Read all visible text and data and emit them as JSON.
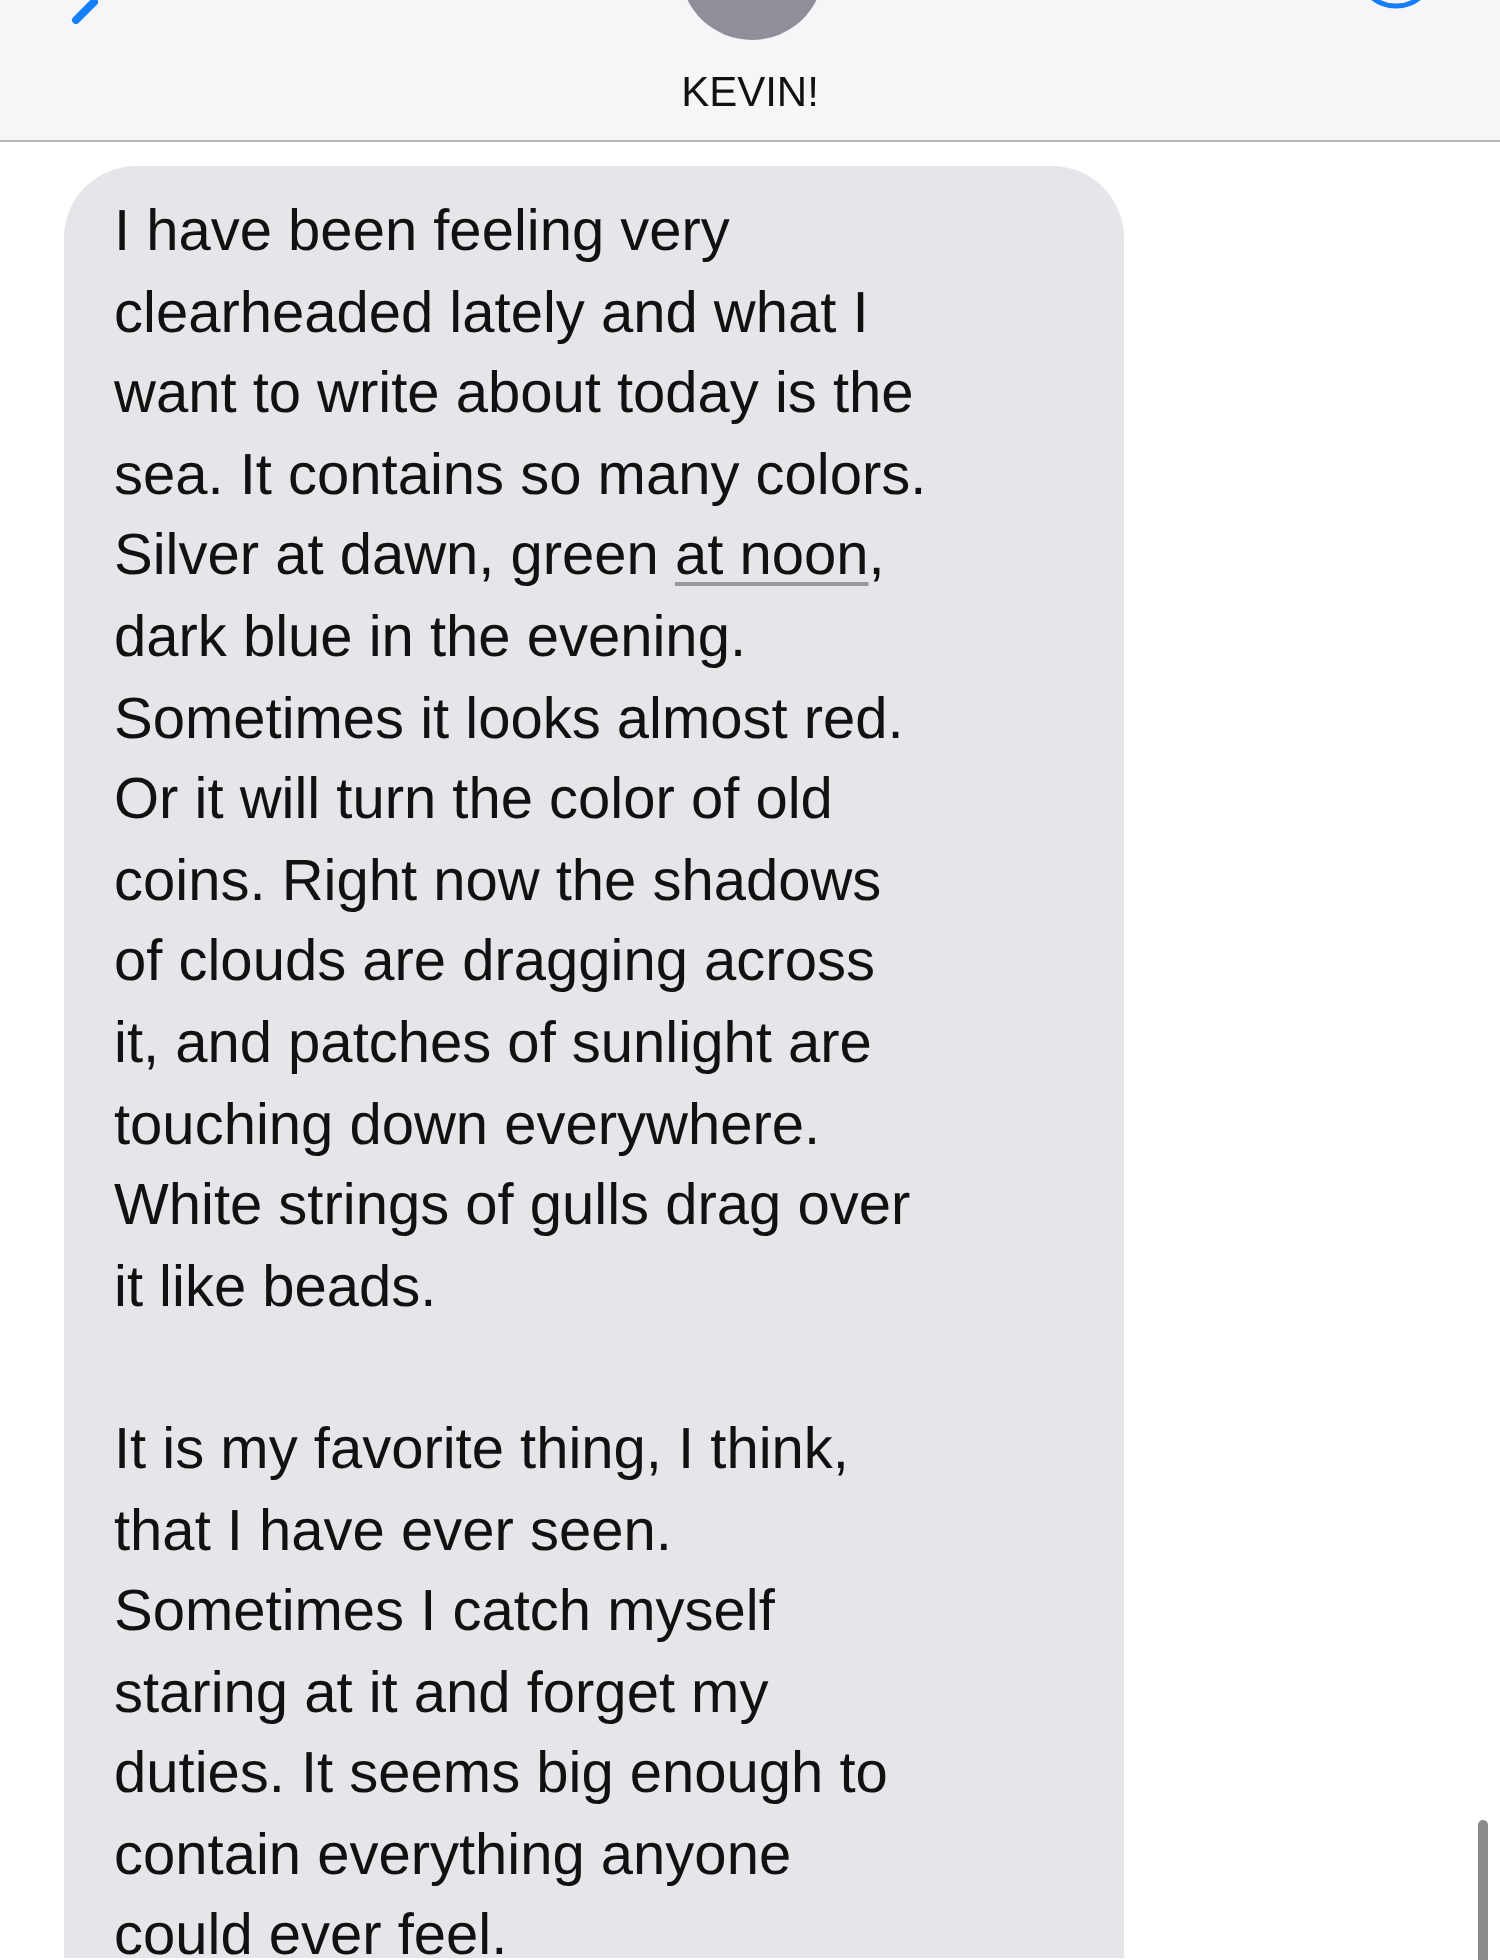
{
  "header": {
    "title": "KEVIN!"
  },
  "messages": [
    {
      "paragraphs": [
        [
          {
            "kind": "text",
            "text": "I have been feeling very\nclearheaded lately and what I\nwant to write about today is the\nsea. It contains so many colors.\nSilver at dawn, green "
          },
          {
            "kind": "link",
            "text": "at noon"
          },
          {
            "kind": "text",
            "text": ",\ndark blue in the evening.\nSometimes it looks almost red.\nOr it will turn the color of old\ncoins. Right now the shadows\nof clouds are dragging across\nit, and patches of sunlight are\ntouching down everywhere.\nWhite strings of gulls drag over\nit like beads."
          }
        ],
        [
          {
            "kind": "text",
            "text": "It is my favorite thing, I think,\nthat I have ever seen.\nSometimes I catch myself\nstaring at it and forget my\nduties. It seems big enough to\ncontain everything anyone\ncould ever feel."
          }
        ]
      ]
    }
  ]
}
